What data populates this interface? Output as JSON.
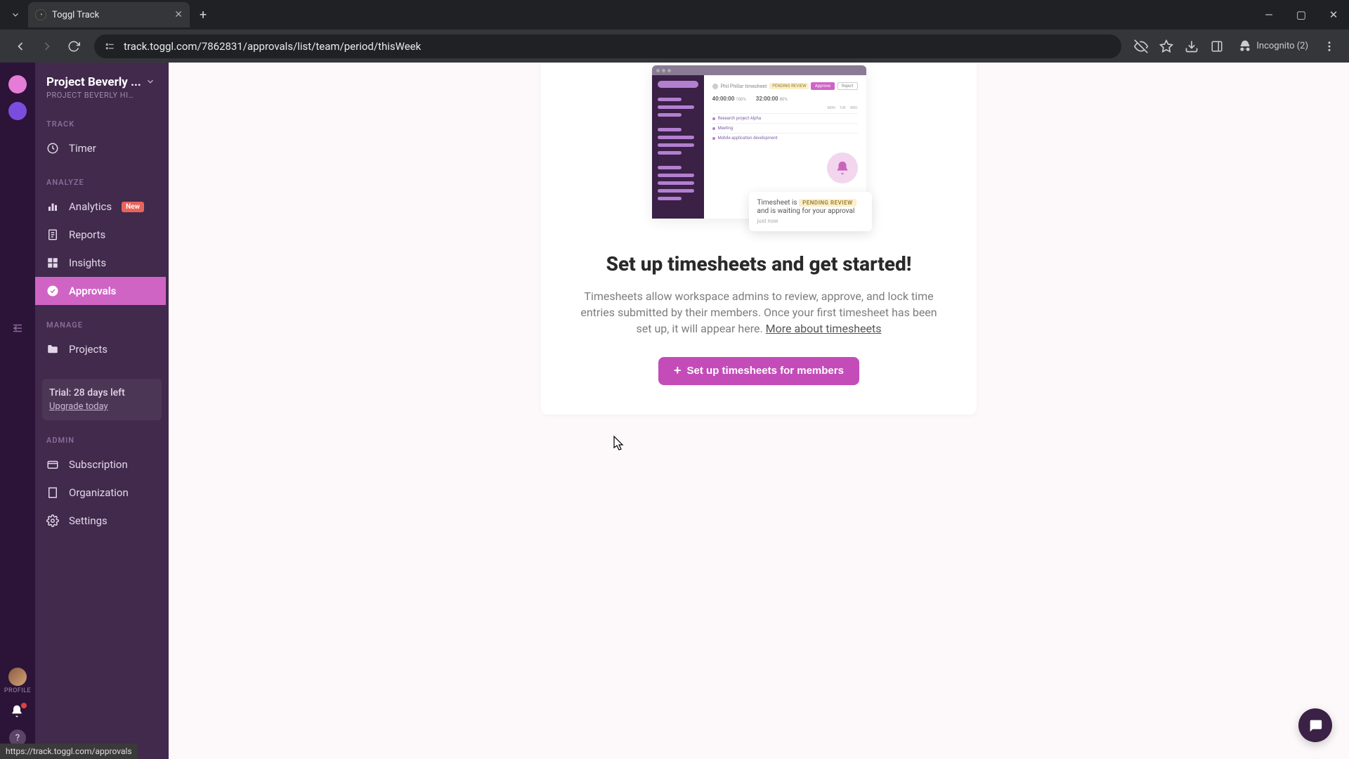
{
  "browser": {
    "tab_title": "Toggl Track",
    "url": "track.toggl.com/7862831/approvals/list/team/period/thisWeek",
    "incognito_label": "Incognito (2)"
  },
  "rail": {
    "profile_label": "PROFILE"
  },
  "sidebar": {
    "workspace_title": "Project Beverly ...",
    "workspace_subtitle": "PROJECT BEVERLY HI…",
    "sections": {
      "track": "TRACK",
      "analyze": "ANALYZE",
      "manage": "MANAGE",
      "admin": "ADMIN"
    },
    "items": {
      "timer": "Timer",
      "analytics": "Analytics",
      "analytics_badge": "New",
      "reports": "Reports",
      "insights": "Insights",
      "approvals": "Approvals",
      "projects": "Projects",
      "subscription": "Subscription",
      "organization": "Organization",
      "settings": "Settings"
    },
    "trial": {
      "title": "Trial: 28 days left",
      "link": "Upgrade today"
    }
  },
  "illustration": {
    "header_text": "Phil Phillar timesheet",
    "pending_badge": "PENDING REVIEW",
    "approve": "Approve",
    "reject": "Reject",
    "stat1_value": "40:00:00",
    "stat1_pct": "100%",
    "stat2_value": "32:00:00",
    "stat2_pct": "80%",
    "days": [
      "MON",
      "TUE",
      "WED"
    ],
    "row1": "Research project Alpha",
    "row2": "Meeting",
    "row3": "Mobile application development",
    "tooltip_line1_pre": "Timesheet is",
    "tooltip_badge": "PENDING REVIEW",
    "tooltip_line2": "and is waiting for your approval",
    "tooltip_time": "just now"
  },
  "empty": {
    "heading": "Set up timesheets and get started!",
    "body": "Timesheets allow workspace admins to review, approve, and lock time entries submitted by their members. Once your first timesheet has been set up, it will appear here. ",
    "more_link": "More about timesheets",
    "cta": "Set up timesheets for members"
  },
  "status_url": "https://track.toggl.com/approvals"
}
